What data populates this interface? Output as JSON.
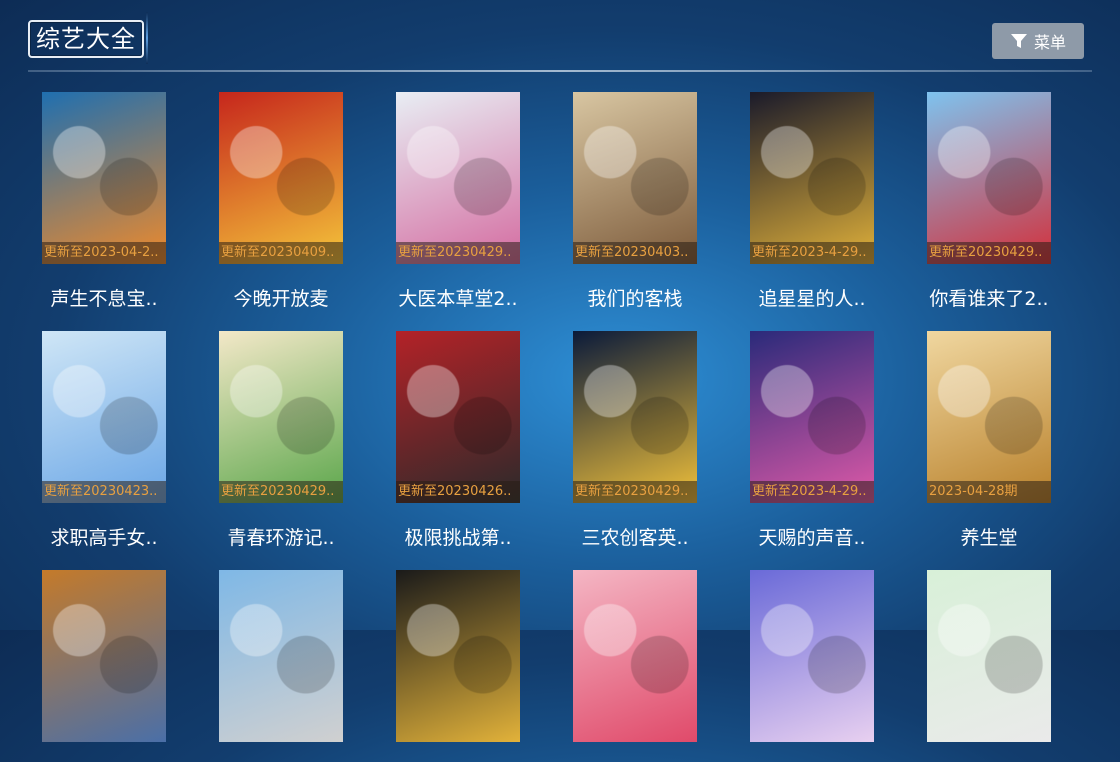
{
  "header": {
    "title": "综艺大全",
    "menu_label": "菜单"
  },
  "items": [
    {
      "title": "声生不息宝..",
      "badge": "更新至2023-04-2..",
      "colors": [
        "#1f6fb0",
        "#f08a2a"
      ],
      "icon": "show-poster"
    },
    {
      "title": "今晚开放麦",
      "badge": "更新至20230409..",
      "colors": [
        "#c6261c",
        "#f4c53a"
      ],
      "icon": "show-poster"
    },
    {
      "title": "大医本草堂2..",
      "badge": "更新至20230429..",
      "colors": [
        "#e8eef4",
        "#d46ba0"
      ],
      "icon": "show-poster"
    },
    {
      "title": "我们的客栈",
      "badge": "更新至20230403..",
      "colors": [
        "#d8c6a2",
        "#7c5a3a"
      ],
      "icon": "show-poster"
    },
    {
      "title": "追星星的人..",
      "badge": "更新至2023-4-29..",
      "colors": [
        "#1a1a2a",
        "#e2b23a"
      ],
      "icon": "show-poster"
    },
    {
      "title": "你看谁来了2..",
      "badge": "更新至20230429..",
      "colors": [
        "#7ec3ef",
        "#d42f3a"
      ],
      "icon": "show-poster"
    },
    {
      "title": "求职高手女..",
      "badge": "更新至20230423..",
      "colors": [
        "#cfe6f6",
        "#6aa6e6"
      ],
      "icon": "show-poster"
    },
    {
      "title": "青春环游记..",
      "badge": "更新至20230429..",
      "colors": [
        "#f3e8c8",
        "#5aa64a"
      ],
      "icon": "show-poster"
    },
    {
      "title": "极限挑战第..",
      "badge": "更新至20230426..",
      "colors": [
        "#b42228",
        "#2a2a2a"
      ],
      "icon": "show-poster"
    },
    {
      "title": "三农创客英..",
      "badge": "更新至20230429..",
      "colors": [
        "#0a1a3a",
        "#f2c23a"
      ],
      "icon": "show-poster"
    },
    {
      "title": "天赐的声音..",
      "badge": "更新至2023-4-29..",
      "colors": [
        "#2a2a7a",
        "#e05aa8"
      ],
      "icon": "show-poster"
    },
    {
      "title": "养生堂",
      "badge": "2023-04-28期",
      "colors": [
        "#f0d7a0",
        "#b8802a"
      ],
      "icon": "show-poster"
    },
    {
      "title": "",
      "badge": "",
      "colors": [
        "#c47a2a",
        "#4a6fa8"
      ],
      "icon": "show-poster"
    },
    {
      "title": "",
      "badge": "",
      "colors": [
        "#7fb8e6",
        "#d0d0d0"
      ],
      "icon": "show-poster"
    },
    {
      "title": "",
      "badge": "",
      "colors": [
        "#1a1a1a",
        "#e2b23a"
      ],
      "icon": "show-poster"
    },
    {
      "title": "",
      "badge": "",
      "colors": [
        "#f4b6c4",
        "#e04a6a"
      ],
      "icon": "show-poster"
    },
    {
      "title": "",
      "badge": "",
      "colors": [
        "#6a6ad8",
        "#e8d0f0"
      ],
      "icon": "show-poster"
    },
    {
      "title": "",
      "badge": "",
      "colors": [
        "#d8f0d8",
        "#eaeaea"
      ],
      "icon": "show-poster"
    }
  ]
}
